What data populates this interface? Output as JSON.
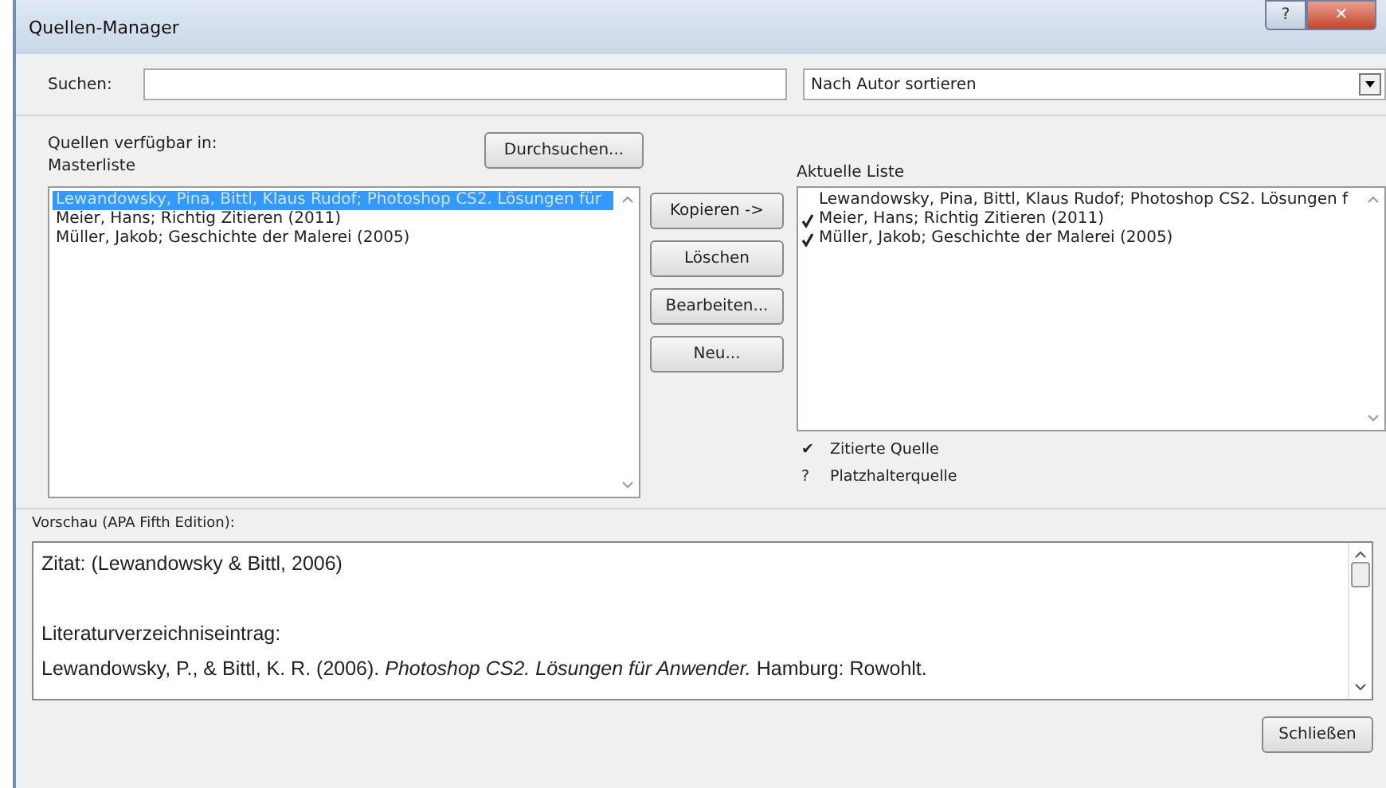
{
  "window": {
    "title": "Quellen-Manager",
    "title_buttons": [
      "?",
      "✕"
    ]
  },
  "search": {
    "label": "Suchen:"
  },
  "sort": {
    "value": "Nach Autor sortieren"
  },
  "source": {
    "label": "Quellen verfügbar in:",
    "list_name": "Masterliste",
    "browse_button": "Durchsuchen..."
  },
  "master_list": [
    {
      "text": "Lewandowsky, Pina, Bittl, Klaus Rudof; Photoshop CS2. Lösungen für",
      "selected": true
    },
    {
      "text": "Meier, Hans; Richtig Zitieren (2011)",
      "selected": false
    },
    {
      "text": "Müller, Jakob; Geschichte der Malerei (2005)",
      "selected": false
    }
  ],
  "actions": [
    "Kopieren ->",
    "Löschen",
    "Bearbeiten...",
    "Neu..."
  ],
  "current_list": {
    "label": "Aktuelle Liste",
    "items": [
      {
        "text": "Lewandowsky, Pina, Bittl, Klaus Rudof; Photoshop CS2. Lösungen f",
        "cited": false
      },
      {
        "text": "Meier, Hans; Richtig Zitieren (2011)",
        "cited": true
      },
      {
        "text": "Müller, Jakob; Geschichte der Malerei (2005)",
        "cited": true
      }
    ]
  },
  "legend": [
    {
      "symbol": "✔",
      "text": "Zitierte Quelle"
    },
    {
      "symbol": "?",
      "text": "Platzhalterquelle"
    }
  ],
  "preview": {
    "label": "Vorschau (APA Fifth Edition):",
    "lines": [
      {
        "kind": "text",
        "text": "Zitat:  (Lewandowsky & Bittl, 2006)"
      },
      {
        "kind": "blank"
      },
      {
        "kind": "text",
        "text": "Literaturverzeichniseintrag:"
      },
      {
        "kind": "text",
        "text": "Lewandowsky, P., & Bittl, K. R. (2006). *Photoshop CS2. Lösungen für Anwender.* Hamburg: Rowohlt."
      }
    ]
  },
  "close_button": "Schließen"
}
